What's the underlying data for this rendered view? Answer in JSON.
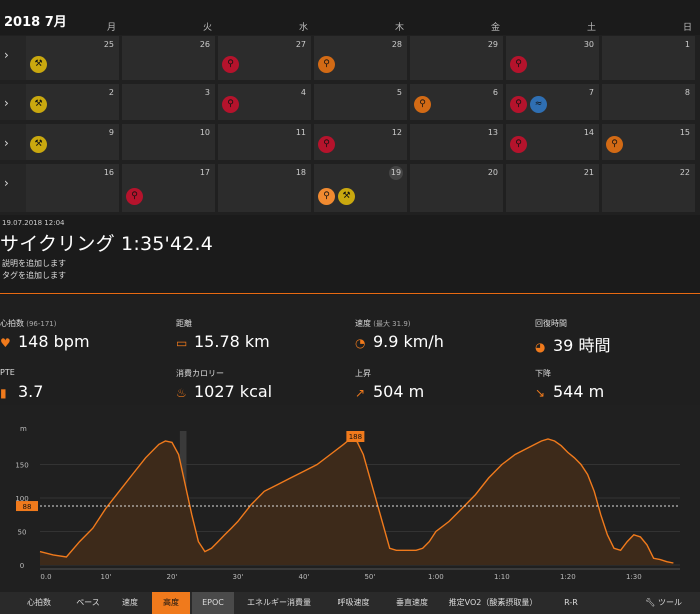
{
  "header": {
    "month_title": "2018 7月",
    "weekdays": [
      "月",
      "火",
      "水",
      "木",
      "金",
      "土",
      "日"
    ]
  },
  "calendar": {
    "week_expand_glyph": "›",
    "weeks": [
      [
        "25",
        "26",
        "27",
        "28",
        "29",
        "30",
        "1"
      ],
      [
        "2",
        "3",
        "4",
        "5",
        "6",
        "7",
        "8"
      ],
      [
        "9",
        "10",
        "11",
        "12",
        "13",
        "14",
        "15"
      ],
      [
        "16",
        "17",
        "18",
        "19",
        "20",
        "21",
        "22"
      ]
    ],
    "activity_icons": {
      "strength": "strength-icon",
      "cycling": "bike-icon",
      "running": "running-icon"
    }
  },
  "activity": {
    "date": "19.07.2018 12:04",
    "title": "サイクリング 1:35'42.4",
    "add_description": "説明を追加します",
    "add_tags": "タグを追加します"
  },
  "stats": [
    {
      "label": "心拍数",
      "sub": "(96-171)",
      "value": "148 bpm",
      "icon": "heart-icon"
    },
    {
      "label": "距離",
      "sub": "",
      "value": "15.78 km",
      "icon": "ruler-icon"
    },
    {
      "label": "速度",
      "sub": "(最大 31.9)",
      "value": "9.9 km/h",
      "icon": "speedometer-icon"
    },
    {
      "label": "回復時間",
      "sub": "",
      "value": "39 時間",
      "icon": "recovery-icon"
    },
    {
      "label": "PTE",
      "sub": "",
      "value": "3.7",
      "icon": "pte-icon"
    },
    {
      "label": "消費カロリー",
      "sub": "",
      "value": "1027 kcal",
      "icon": "flame-icon"
    },
    {
      "label": "上昇",
      "sub": "",
      "value": "504 m",
      "icon": "arrow-up-icon"
    },
    {
      "label": "下降",
      "sub": "",
      "value": "544 m",
      "icon": "arrow-down-icon"
    }
  ],
  "chart_data": {
    "type": "area",
    "ylabel_unit": "m",
    "ylim": [
      0,
      200
    ],
    "yticks": [
      "0",
      "50",
      "100",
      "150"
    ],
    "xticks": [
      "0.0",
      "10'",
      "20'",
      "30'",
      "40'",
      "50'",
      "1:00",
      "1:10",
      "1:20",
      "1:30"
    ],
    "max_marker": "188",
    "avg_marker": "88",
    "series": [
      {
        "x": [
          0,
          2,
          4,
          6,
          8,
          10,
          12,
          14,
          16,
          18,
          19,
          20,
          21,
          22,
          23,
          24,
          25,
          26,
          27,
          28,
          29,
          30,
          32,
          34,
          36,
          38,
          40,
          42,
          44,
          46,
          47,
          48,
          49,
          50,
          51,
          52,
          53,
          54,
          55,
          56,
          57,
          58,
          59,
          60,
          62,
          64,
          66,
          68,
          70,
          72,
          74,
          76,
          77,
          78,
          79,
          80,
          81,
          82,
          83,
          84,
          85,
          86,
          87,
          88,
          89,
          90,
          91,
          92,
          93,
          94,
          95,
          96
        ],
        "y": [
          20,
          15,
          12,
          35,
          55,
          85,
          110,
          135,
          160,
          180,
          185,
          183,
          165,
          120,
          75,
          35,
          20,
          25,
          35,
          45,
          55,
          65,
          90,
          110,
          120,
          130,
          140,
          150,
          165,
          180,
          188,
          185,
          165,
          130,
          95,
          60,
          25,
          22,
          22,
          22,
          22,
          25,
          35,
          50,
          65,
          85,
          105,
          130,
          150,
          165,
          175,
          185,
          188,
          185,
          178,
          168,
          160,
          150,
          135,
          110,
          75,
          45,
          25,
          22,
          35,
          45,
          42,
          30,
          10,
          8,
          5,
          3
        ]
      }
    ],
    "shaded_bands": [
      [
        21.2,
        22.2
      ],
      [
        47.2,
        48.4
      ]
    ],
    "xlim": [
      0,
      97
    ]
  },
  "tabs": [
    "心拍数",
    "ペース",
    "速度",
    "高度",
    "EPOC",
    "エネルギー消費量",
    "呼吸速度",
    "垂直速度",
    "推定VO2（酸素摂取量）",
    "R-R",
    "ツール"
  ],
  "colors": {
    "accent": "#f07a1c",
    "strength": "#c9a80f",
    "cycling_red": "#b5132c",
    "cycling_orange": "#d26a15",
    "swim_blue": "#2f6fb3"
  }
}
